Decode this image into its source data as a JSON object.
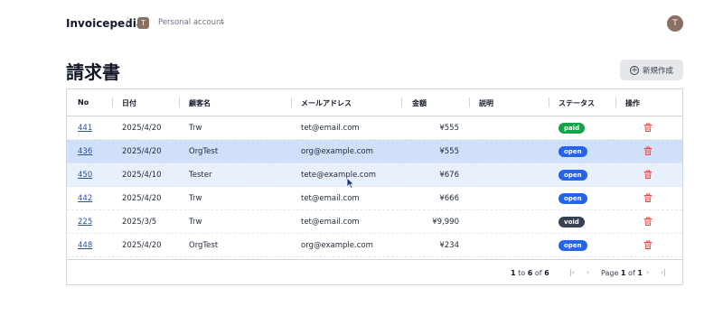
{
  "header": {
    "brand": "Invoicepedia",
    "separator": "/",
    "account_initial": "T",
    "account_name": "Personal account",
    "user_initial": "T"
  },
  "page": {
    "title": "請求書",
    "new_button": "新規作成"
  },
  "table": {
    "columns": [
      "No",
      "日付",
      "顧客名",
      "メールアドレス",
      "金額",
      "説明",
      "ステータス",
      "操作"
    ],
    "rows": [
      {
        "no": "441",
        "date": "2025/4/20",
        "customer": "Trw",
        "email": "tet@email.com",
        "amount": "¥555",
        "desc": "",
        "status": "paid"
      },
      {
        "no": "436",
        "date": "2025/4/20",
        "customer": "OrgTest",
        "email": "org@example.com",
        "amount": "¥555",
        "desc": "",
        "status": "open"
      },
      {
        "no": "450",
        "date": "2025/4/10",
        "customer": "Tester",
        "email": "tete@example.com",
        "amount": "¥676",
        "desc": "",
        "status": "open"
      },
      {
        "no": "442",
        "date": "2025/4/20",
        "customer": "Trw",
        "email": "tet@email.com",
        "amount": "¥666",
        "desc": "",
        "status": "open"
      },
      {
        "no": "225",
        "date": "2025/3/5",
        "customer": "Trw",
        "email": "tet@email.com",
        "amount": "¥9,990",
        "desc": "",
        "status": "void"
      },
      {
        "no": "448",
        "date": "2025/4/20",
        "customer": "OrgTest",
        "email": "org@example.com",
        "amount": "¥234",
        "desc": "",
        "status": "open"
      }
    ]
  },
  "pagination": {
    "from": "1",
    "to_word": "to",
    "to": "6",
    "of_word": "of",
    "total": "6",
    "page_word": "Page",
    "page": "1",
    "page_of": "of",
    "page_total": "1"
  },
  "colors": {
    "paid": "#16a34a",
    "open": "#2563eb",
    "void": "#374151",
    "trash": "#ef4444",
    "link": "#2b4fa8",
    "selected_row": "#cfe0f8",
    "hover_row": "#e8f0fc"
  },
  "icons": [
    "chevron-down-icon",
    "plus-circle-icon",
    "trash-icon",
    "first-page-icon",
    "prev-page-icon",
    "next-page-icon",
    "last-page-icon",
    "cursor-icon"
  ]
}
